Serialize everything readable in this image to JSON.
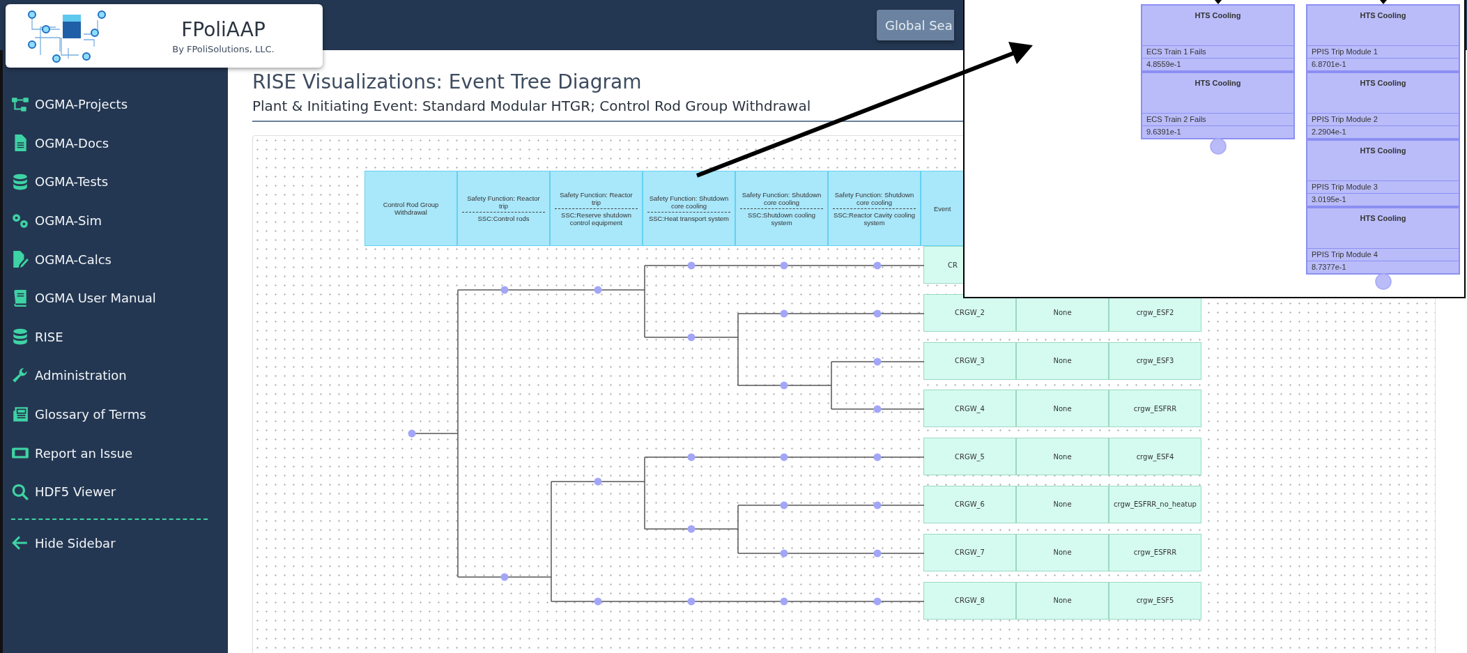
{
  "logo": {
    "title": "FPoliAAP",
    "subtitle": "By FPoliSolutions, LLC."
  },
  "top_bar": {
    "search_button": "Global Sea"
  },
  "sidebar": {
    "items": [
      {
        "label": "OGMA-Projects"
      },
      {
        "label": "OGMA-Docs"
      },
      {
        "label": "OGMA-Tests"
      },
      {
        "label": "OGMA-Sim"
      },
      {
        "label": "OGMA-Calcs"
      },
      {
        "label": "OGMA User Manual"
      },
      {
        "label": "RISE"
      },
      {
        "label": "Administration"
      },
      {
        "label": "Glossary of Terms"
      },
      {
        "label": "Report an Issue"
      },
      {
        "label": "HDF5 Viewer"
      }
    ],
    "hide": "Hide Sidebar"
  },
  "page": {
    "title": "RISE Visualizations: Event Tree Diagram",
    "subtitle": "Plant & Initiating Event: Standard Modular HTGR; Control Rod Group Withdrawal"
  },
  "event_tree": {
    "headers": [
      {
        "function": "Control Rod Group Withdrawal"
      },
      {
        "function": "Safety Function: Reactor trip",
        "ssc": "SSC:Control rods"
      },
      {
        "function": "Safety Function: Reactor trip",
        "ssc": "SSC:Reserve shutdown control equipment"
      },
      {
        "function": "Safety Function: Shutdown core cooling",
        "ssc": "SSC:Heat transport system"
      },
      {
        "function": "Safety Function: Shutdown core cooling",
        "ssc": "SSC:Shutdown cooling system"
      },
      {
        "function": "Safety Function: Shutdown core cooling",
        "ssc": "SSC:Reactor Cavity cooling system"
      },
      {
        "function": "Event"
      }
    ],
    "outcomes": [
      {
        "cells": [
          "CR"
        ]
      },
      {
        "cells": [
          "CRGW_2",
          "None",
          "crgw_ESF2"
        ]
      },
      {
        "cells": [
          "CRGW_3",
          "None",
          "crgw_ESF3"
        ]
      },
      {
        "cells": [
          "CRGW_4",
          "None",
          "crgw_ESFRR"
        ]
      },
      {
        "cells": [
          "CRGW_5",
          "None",
          "crgw_ESF4"
        ]
      },
      {
        "cells": [
          "CRGW_6",
          "None",
          "crgw_ESFRR_no_heatup"
        ]
      },
      {
        "cells": [
          "CRGW_7",
          "None",
          "crgw_ESFRR"
        ]
      },
      {
        "cells": [
          "CRGW_8",
          "None",
          "crgw_ESF5"
        ]
      }
    ]
  },
  "inset": {
    "columns": [
      {
        "boxes": [
          {
            "heading": "HTS Cooling",
            "label": "ECS Train 1 Fails",
            "value": "4.8559e-1"
          },
          {
            "heading": "HTS Cooling",
            "label": "ECS Train 2 Fails",
            "value": "9.6391e-1"
          }
        ]
      },
      {
        "boxes": [
          {
            "heading": "HTS Cooling",
            "label": "PPIS Trip Module 1",
            "value": "6.8701e-1"
          },
          {
            "heading": "HTS Cooling",
            "label": "PPIS Trip Module 2",
            "value": "2.2904e-1"
          },
          {
            "heading": "HTS Cooling",
            "label": "PPIS Trip Module 3",
            "value": "3.0195e-1"
          },
          {
            "heading": "HTS Cooling",
            "label": "PPIS Trip Module 4",
            "value": "8.7377e-1"
          }
        ]
      }
    ]
  }
}
